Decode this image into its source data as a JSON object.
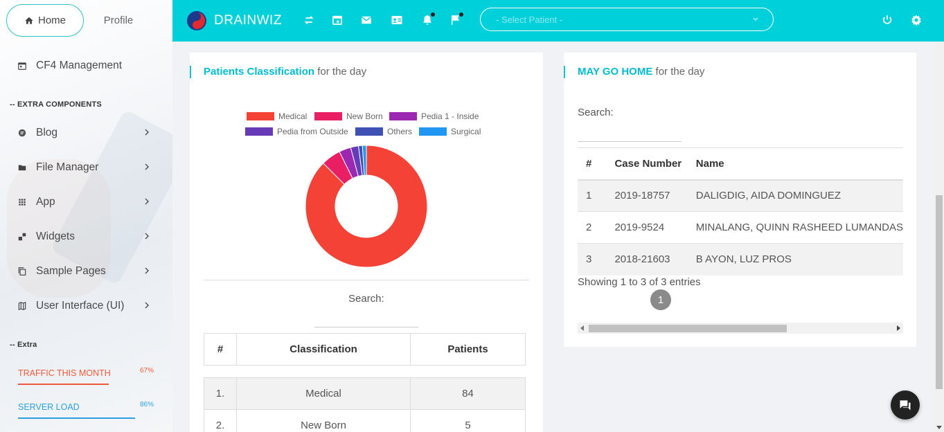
{
  "sidebar": {
    "tabs": {
      "home": "Home",
      "profile": "Profile"
    },
    "cf4": "CF4 Management",
    "extra_components_header": "-- EXTRA COMPONENTS",
    "items": [
      {
        "label": "Blog",
        "icon": "blog-icon"
      },
      {
        "label": "File Manager",
        "icon": "folder-icon"
      },
      {
        "label": "App",
        "icon": "grid-icon"
      },
      {
        "label": "Widgets",
        "icon": "widgets-icon"
      },
      {
        "label": "Sample Pages",
        "icon": "copy-icon"
      },
      {
        "label": "User Interface (UI)",
        "icon": "map-icon"
      }
    ],
    "extra_header": "-- Extra",
    "stats": [
      {
        "label": "TRAFFIC THIS MONTH",
        "percent": "67%",
        "value": 67,
        "color": "#f0583a"
      },
      {
        "label": "SERVER LOAD",
        "percent": "86%",
        "value": 86,
        "color": "#2b9fe0"
      }
    ]
  },
  "header": {
    "brand": "DRAINWIZ",
    "select_placeholder": "- Select Patient -",
    "color": "#00d0da"
  },
  "classification": {
    "title_bold": "Patients Classification",
    "title_rest": " for the day",
    "search_label": "Search:",
    "columns": [
      "#",
      "Classification",
      "Patients"
    ],
    "rows": [
      {
        "num": "1.",
        "name": "Medical",
        "patients": "84"
      },
      {
        "num": "2.",
        "name": "New Born",
        "patients": "5"
      }
    ]
  },
  "chart_data": {
    "type": "pie",
    "legend": [
      {
        "name": "Medical",
        "color": "#f44336"
      },
      {
        "name": "New Born",
        "color": "#e91e63"
      },
      {
        "name": "Pedia 1 - Inside",
        "color": "#9c27b0"
      },
      {
        "name": "Pedia from Outside",
        "color": "#673ab7"
      },
      {
        "name": "Others",
        "color": "#3f51b5"
      },
      {
        "name": "Surgical",
        "color": "#2196f3"
      }
    ],
    "categories": [
      "Medical",
      "New Born",
      "Pedia 1 - Inside",
      "Pedia from Outside",
      "Others",
      "Surgical"
    ],
    "values": [
      84,
      5,
      3,
      2,
      1,
      1
    ],
    "legend_position": "top"
  },
  "may_go_home": {
    "title_bold": "MAY GO HOME",
    "title_rest": " for the day",
    "search_label": "Search:",
    "columns": [
      "#",
      "Case Number",
      "Name"
    ],
    "rows": [
      {
        "num": "1",
        "case": "2019-18757",
        "name": "DALIGDIG, AIDA DOMINGUEZ"
      },
      {
        "num": "2",
        "case": "2019-9524",
        "name": "MINALANG, QUINN RASHEED LUMANDAS"
      },
      {
        "num": "3",
        "case": "2018-21603",
        "name": "B AYON, LUZ PROS"
      }
    ],
    "info": "Showing 1 to 3 of 3 entries",
    "page": "1"
  }
}
